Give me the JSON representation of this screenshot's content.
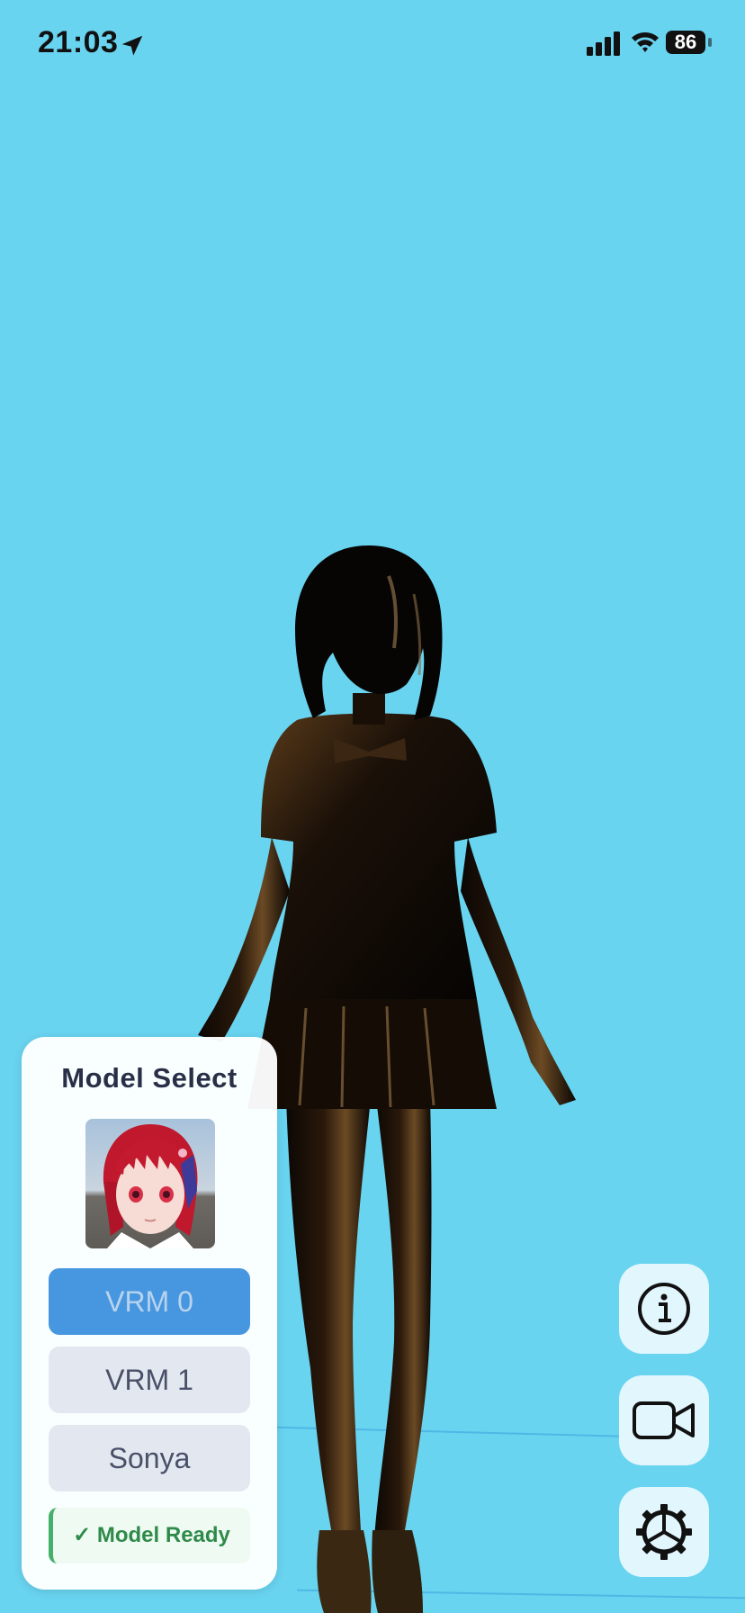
{
  "status_bar": {
    "time": "21:03",
    "battery_level": "86",
    "icons": [
      "location-arrow-icon",
      "cellular-signal-icon",
      "wifi-icon",
      "battery-icon"
    ]
  },
  "scene": {
    "background_color": "#69d4f0",
    "figure": "3d-anime-avatar-silhouette"
  },
  "model_panel": {
    "title": "Model Select",
    "thumbnail": "avatar-preview",
    "options": [
      {
        "label": "VRM 0",
        "selected": true
      },
      {
        "label": "VRM 1",
        "selected": false
      },
      {
        "label": "Sonya",
        "selected": false
      }
    ],
    "status": "✓ Model Ready"
  },
  "actions": [
    {
      "icon": "info-icon"
    },
    {
      "icon": "video-camera-icon"
    },
    {
      "icon": "settings-gear-icon"
    }
  ],
  "colors": {
    "accent": "#4797e0",
    "ready_green": "#2f8a4a",
    "panel_bg": "#ffffff",
    "fab_bg": "#e2f6fd"
  }
}
